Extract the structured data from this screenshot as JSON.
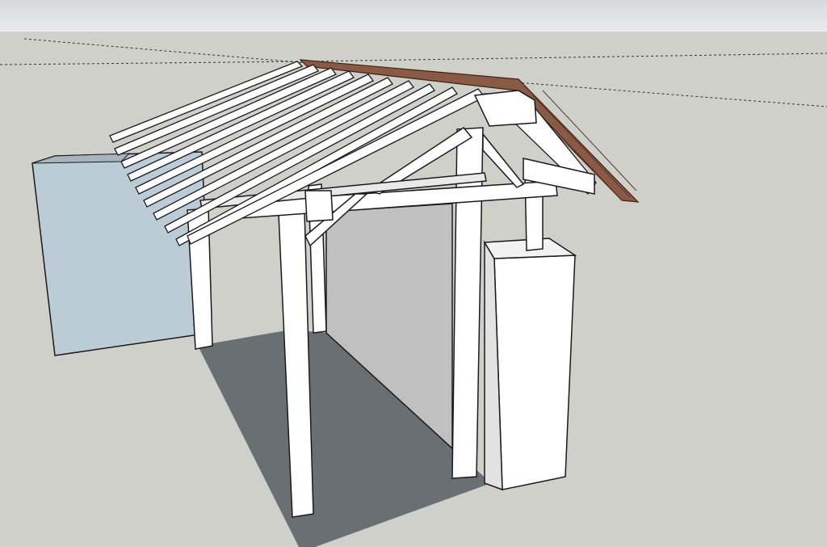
{
  "viewport": {
    "sky_color": "#e4e7e9",
    "ground_color": "#d0d0cb"
  },
  "model": {
    "type": "timber-frame-shelter",
    "colors": {
      "wall_blue": "#bcccd6",
      "shadow_floor": "#6a6f73",
      "back_wall": "#c0c0c0",
      "timber_white": "#ffffff",
      "timber_shade": "#e2e2e2",
      "roof_tiles": "#8b5a45",
      "edge_stroke": "#1a1a1a"
    },
    "icons": [
      "axis-line"
    ]
  }
}
